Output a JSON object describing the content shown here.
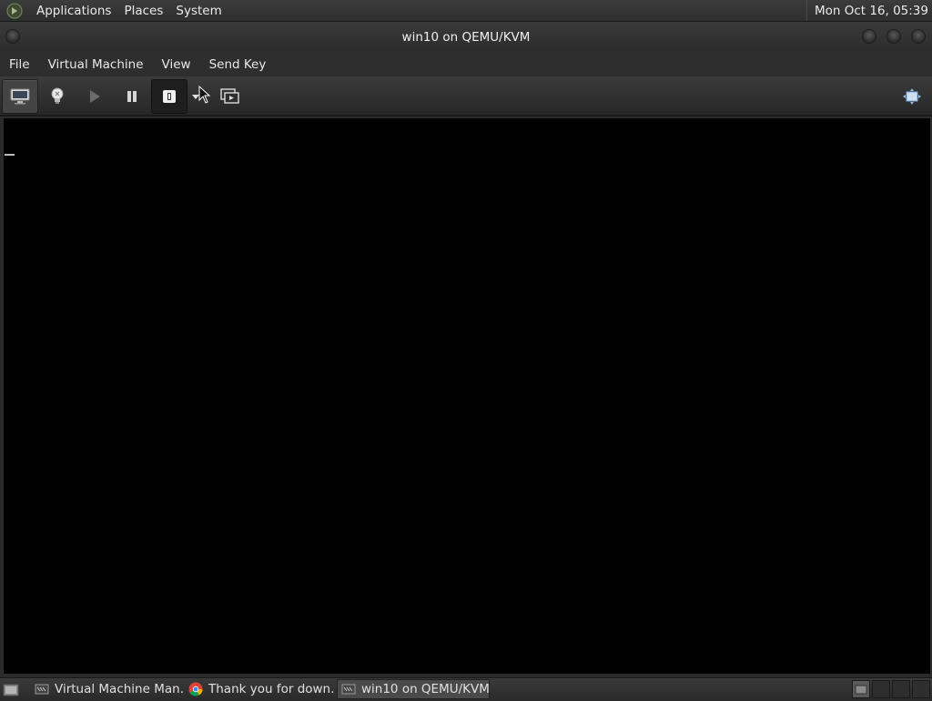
{
  "top_panel": {
    "menus": [
      "Applications",
      "Places",
      "System"
    ],
    "clock": "Mon Oct 16, 05:39"
  },
  "window": {
    "title": "win10 on QEMU/KVM"
  },
  "menubar": {
    "items": [
      "File",
      "Virtual Machine",
      "View",
      "Send Key"
    ]
  },
  "toolbar": {
    "buttons": [
      {
        "icon": "monitor-icon",
        "state": "active"
      },
      {
        "icon": "lightbulb-icon",
        "state": "normal"
      },
      {
        "icon": "play-icon",
        "state": "disabled"
      },
      {
        "icon": "pause-icon",
        "state": "normal"
      },
      {
        "icon": "power-icon",
        "state": "pressed"
      },
      {
        "icon": "dropdown-arrow-icon",
        "state": "normal"
      },
      {
        "icon": "snapshots-icon",
        "state": "normal"
      }
    ],
    "right_button": {
      "icon": "fullscreen-icon"
    }
  },
  "taskbar": {
    "tasks": [
      {
        "label": "Virtual Machine Man…",
        "icon": "vm-manager-icon",
        "active": false
      },
      {
        "label": "Thank you for down…",
        "icon": "chrome-icon",
        "active": false
      },
      {
        "label": "win10 on QEMU/KVM",
        "icon": "vm-console-icon",
        "active": true
      }
    ]
  },
  "colors": {
    "panel_bg": "#2e2e2e",
    "display_bg": "#000000",
    "text": "#e6e6e6"
  }
}
